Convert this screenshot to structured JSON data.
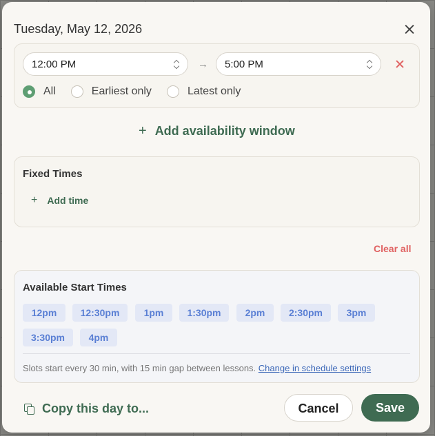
{
  "dialog": {
    "title": "Tuesday, May 12, 2026"
  },
  "window": {
    "start_time": "12:00 PM",
    "end_time": "5:00 PM",
    "arrow": "→",
    "options": [
      {
        "label": "All",
        "selected": true
      },
      {
        "label": "Earliest only",
        "selected": false
      },
      {
        "label": "Latest only",
        "selected": false
      }
    ]
  },
  "add_window_label": "Add availability window",
  "fixed_times": {
    "title": "Fixed Times",
    "add_label": "Add time"
  },
  "clear_all_label": "Clear all",
  "available": {
    "title": "Available Start Times",
    "slots": [
      "12pm",
      "12:30pm",
      "1pm",
      "1:30pm",
      "2pm",
      "2:30pm",
      "3pm",
      "3:30pm",
      "4pm"
    ],
    "note": "Slots start every 30 min, with 15 min gap between lessons.",
    "settings_link": "Change in schedule settings"
  },
  "footer": {
    "copy_label": "Copy this day to...",
    "cancel_label": "Cancel",
    "save_label": "Save"
  },
  "colors": {
    "accent": "#3f6b52",
    "radio_on": "#5e9e73",
    "danger": "#e06060",
    "slot_text": "#5a7fd4",
    "slot_bg": "#e3e8f6"
  }
}
